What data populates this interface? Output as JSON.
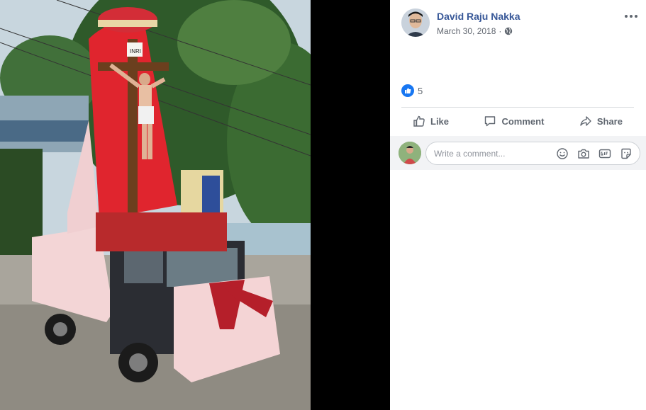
{
  "post": {
    "author": "David Raju Nakka",
    "date": "March 30, 2018",
    "privacy_icon": "globe-icon",
    "reaction_count": "5"
  },
  "actions": {
    "like": "Like",
    "comment": "Comment",
    "share": "Share"
  },
  "composer": {
    "placeholder": "Write a comment...",
    "icons": [
      "emoji-icon",
      "camera-icon",
      "gif-icon",
      "sticker-icon"
    ]
  },
  "photo": {
    "sign_text": "INRI"
  },
  "colors": {
    "link": "#385898",
    "muted": "#606770",
    "accent": "#1877f2",
    "composer_bg": "#f2f3f5",
    "banner_red": "#e0252e"
  }
}
